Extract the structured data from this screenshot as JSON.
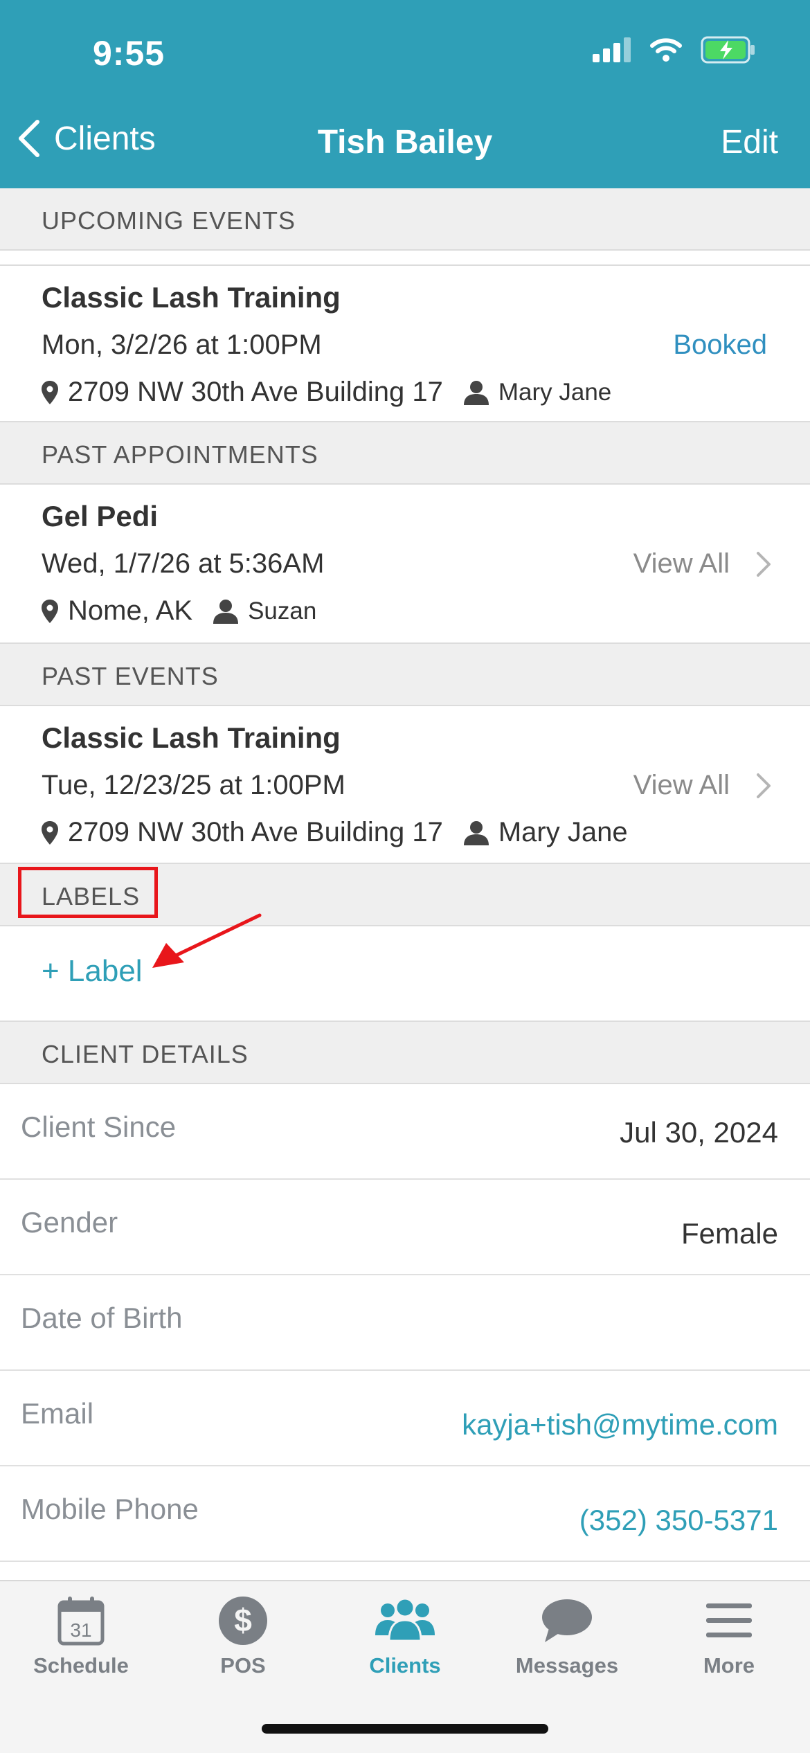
{
  "status_bar": {
    "time": "9:55"
  },
  "nav": {
    "back_label": "Clients",
    "title": "Tish Bailey",
    "edit_label": "Edit"
  },
  "upcoming_events": {
    "header": "UPCOMING EVENTS",
    "items": [
      {
        "title": "Classic Lash Training",
        "date": "Mon, 3/2/26 at 1:00PM",
        "location": "2709 NW 30th Ave Building 17",
        "staff": "Mary Jane",
        "status": "Booked"
      }
    ]
  },
  "past_appointments": {
    "header": "PAST APPOINTMENTS",
    "items": [
      {
        "title": "Gel Pedi",
        "date": "Wed, 1/7/26 at 5:36AM",
        "location": "Nome, AK",
        "staff": "Suzan",
        "view_all": "View All"
      }
    ]
  },
  "past_events": {
    "header": "PAST EVENTS",
    "items": [
      {
        "title": "Classic Lash Training",
        "date": "Tue, 12/23/25 at 1:00PM",
        "location": "2709 NW 30th Ave Building 17",
        "staff": "Mary Jane",
        "view_all": "View All"
      }
    ]
  },
  "labels": {
    "header": "LABELS",
    "add_label": "+ Label"
  },
  "client_details": {
    "header": "CLIENT DETAILS",
    "rows": [
      {
        "label": "Client Since",
        "value": "Jul 30, 2024"
      },
      {
        "label": "Gender",
        "value": "Female"
      },
      {
        "label": "Date of Birth",
        "value": ""
      },
      {
        "label": "Email",
        "value": "kayja+tish@mytime.com"
      },
      {
        "label": "Mobile Phone",
        "value": "(352) 350-5371"
      }
    ]
  },
  "tabbar": {
    "tabs": [
      {
        "label": "Schedule",
        "icon": "calendar-icon",
        "calendar_day": "31"
      },
      {
        "label": "POS",
        "icon": "dollar-icon"
      },
      {
        "label": "Clients",
        "icon": "clients-icon",
        "active": true
      },
      {
        "label": "Messages",
        "icon": "chat-bubble-icon"
      },
      {
        "label": "More",
        "icon": "hamburger-menu-icon"
      }
    ]
  },
  "colors": {
    "header_bg": "#2f9fb7",
    "accent": "#2f9fb7",
    "booked": "#2f8fbf",
    "highlight": "#e8161b"
  }
}
